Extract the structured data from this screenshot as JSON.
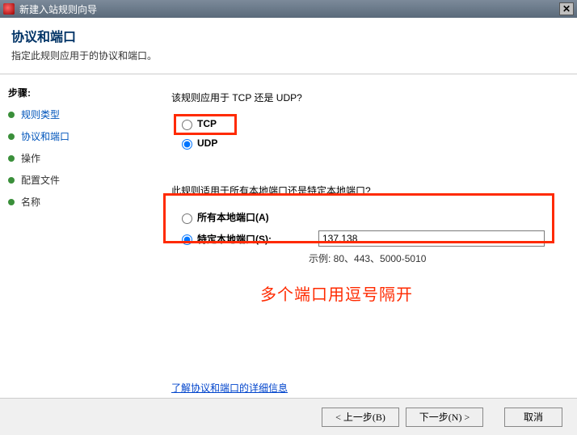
{
  "titlebar": {
    "title": "新建入站规则向导"
  },
  "header": {
    "title": "协议和端口",
    "subtitle": "指定此规则应用于的协议和端口。"
  },
  "sidebar": {
    "steps_label": "步骤:",
    "steps": [
      {
        "label": "规则类型"
      },
      {
        "label": "协议和端口"
      },
      {
        "label": "操作"
      },
      {
        "label": "配置文件"
      },
      {
        "label": "名称"
      }
    ]
  },
  "content": {
    "q1": "该规则应用于 TCP 还是 UDP?",
    "tcp": "TCP",
    "udp": "UDP",
    "q2": "此规则适用于所有本地端口还是特定本地端口?",
    "all_ports": "所有本地端口(A)",
    "specific_ports": "特定本地端口(S):",
    "port_value": "137,138",
    "example": "示例: 80、443、5000-5010",
    "annotation": "多个端口用逗号隔开",
    "link": "了解协议和端口的详细信息"
  },
  "footer": {
    "back": "< 上一步(B)",
    "next": "下一步(N) >",
    "cancel": "取消"
  }
}
